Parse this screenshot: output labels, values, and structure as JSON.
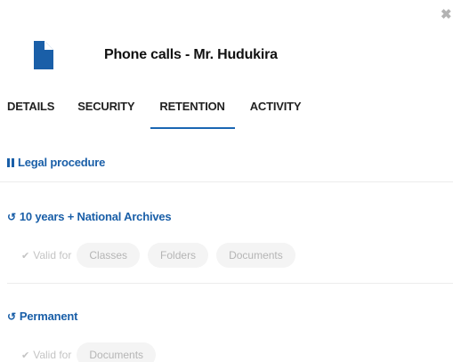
{
  "close_icon": "close-icon",
  "header": {
    "title": "Phone calls - Mr. Hudukira",
    "icon": "document-icon",
    "icon_color": "#1a5fa8"
  },
  "tabs": [
    {
      "label": "DETAILS",
      "active": false
    },
    {
      "label": "SECURITY",
      "active": false
    },
    {
      "label": "RETENTION",
      "active": true
    },
    {
      "label": "ACTIVITY",
      "active": false
    }
  ],
  "accent_color": "#1a66b3",
  "procedure": {
    "label": "Legal procedure",
    "icon": "pause-icon"
  },
  "rules": [
    {
      "label": "10 years + National Archives",
      "icon": "history-icon",
      "valid_label": "Valid for",
      "chips": [
        "Classes",
        "Folders",
        "Documents"
      ]
    },
    {
      "label": "Permanent",
      "icon": "history-icon",
      "valid_label": "Valid for",
      "chips": [
        "Documents"
      ]
    }
  ]
}
